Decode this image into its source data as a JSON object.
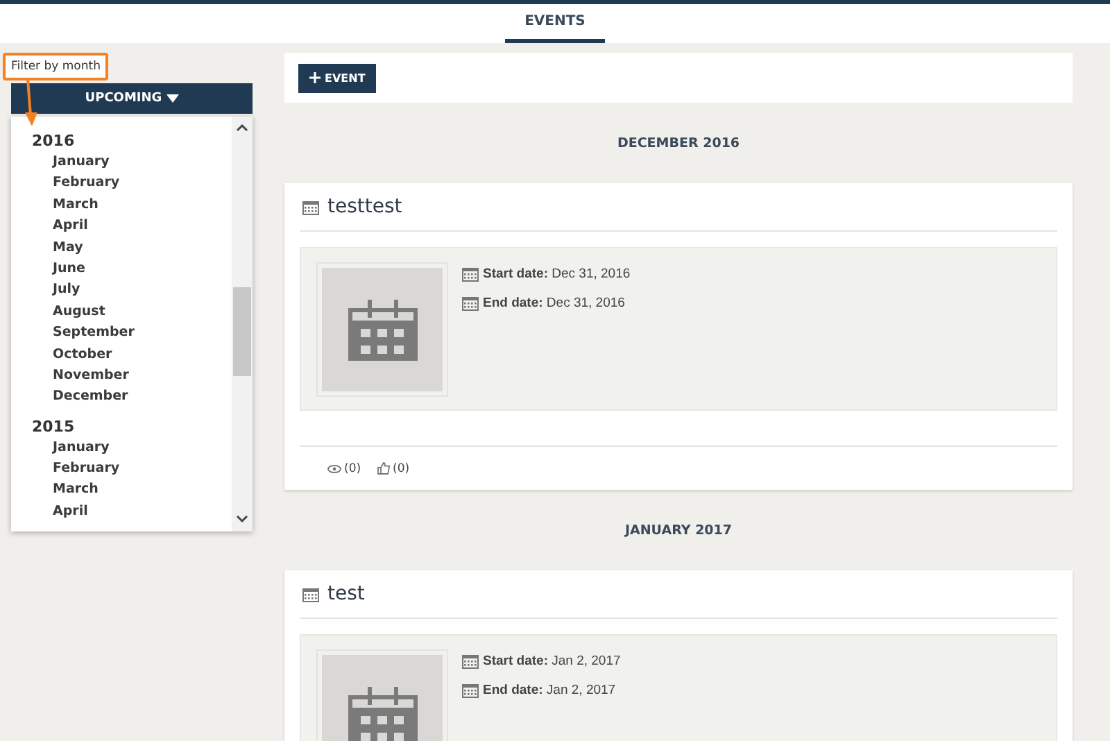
{
  "tabs": [
    {
      "label": "EVENTS",
      "selected": true
    }
  ],
  "annotation": {
    "label": "Filter by month"
  },
  "filter_button": {
    "label": "UPCOMING"
  },
  "month_list": [
    {
      "year": "2016",
      "months": [
        "January",
        "February",
        "March",
        "April",
        "May",
        "June",
        "July",
        "August",
        "September",
        "October",
        "November",
        "December"
      ]
    },
    {
      "year": "2015",
      "months": [
        "January",
        "February",
        "March",
        "April"
      ]
    }
  ],
  "toolbar": {
    "add_button": "EVENT"
  },
  "groups": [
    {
      "heading": "DECEMBER 2016",
      "events": [
        {
          "title": "testtest",
          "start_label": "Start date:",
          "start": "Dec 31, 2016",
          "end_label": "End date:",
          "end": "Dec 31, 2016",
          "views": "(0)",
          "likes": "(0)"
        }
      ]
    },
    {
      "heading": "JANUARY 2017",
      "events": [
        {
          "title": "test",
          "start_label": "Start date:",
          "start": "Jan 2, 2017",
          "end_label": "End date:",
          "end": "Jan 2, 2017"
        }
      ]
    }
  ]
}
